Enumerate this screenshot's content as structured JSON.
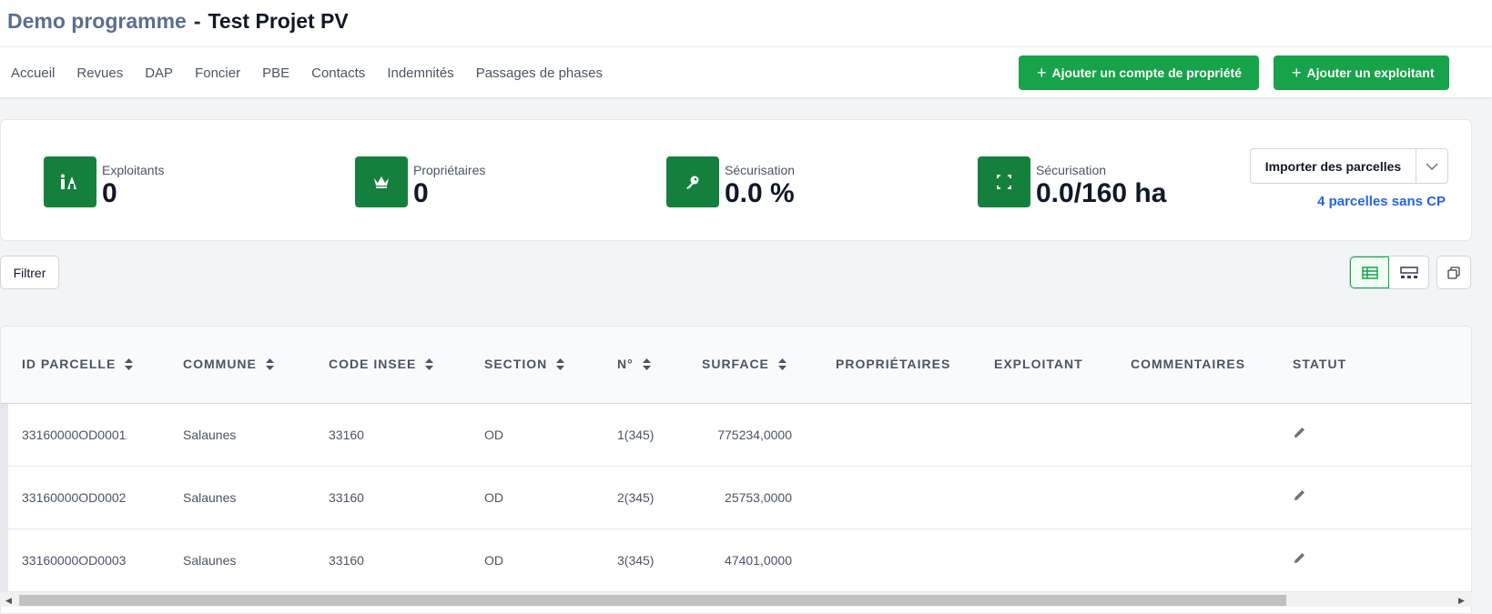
{
  "header": {
    "program": "Demo programme",
    "separator": "-",
    "project": "Test Projet PV"
  },
  "nav": {
    "items": [
      "Accueil",
      "Revues",
      "DAP",
      "Foncier",
      "PBE",
      "Contacts",
      "Indemnités",
      "Passages de phases"
    ]
  },
  "actions": {
    "add_property": "Ajouter un compte de propriété",
    "add_operator": "Ajouter un exploitant"
  },
  "stats": [
    {
      "label": "Exploitants",
      "value": "0",
      "icon": "operator-icon"
    },
    {
      "label": "Propriétaires",
      "value": "0",
      "icon": "crown-icon"
    },
    {
      "label": "Sécurisation",
      "value": "0.0 %",
      "icon": "key-icon"
    },
    {
      "label": "Sécurisation",
      "value": "0.0/160 ha",
      "icon": "area-icon"
    }
  ],
  "import": {
    "label": "Importer des parcelles",
    "link": "4 parcelles sans CP"
  },
  "toolbar": {
    "filter": "Filtrer"
  },
  "table": {
    "headers": [
      "ID PARCELLE",
      "COMMUNE",
      "CODE INSEE",
      "SECTION",
      "N°",
      "SURFACE",
      "PROPRIÉTAIRES",
      "EXPLOITANT",
      "COMMENTAIRES",
      "STATUT"
    ],
    "rows": [
      {
        "id": "33160000OD0001",
        "commune": "Salaunes",
        "insee": "33160",
        "section": "OD",
        "num": "1(345)",
        "surface": "775234,0000"
      },
      {
        "id": "33160000OD0002",
        "commune": "Salaunes",
        "insee": "33160",
        "section": "OD",
        "num": "2(345)",
        "surface": "25753,0000"
      },
      {
        "id": "33160000OD0003",
        "commune": "Salaunes",
        "insee": "33160",
        "section": "OD",
        "num": "3(345)",
        "surface": "47401,0000"
      }
    ]
  },
  "colors": {
    "accent": "#16a34a",
    "icon_bg": "#15803d",
    "link": "#2563eb",
    "program_title": "#5a6f8e"
  }
}
